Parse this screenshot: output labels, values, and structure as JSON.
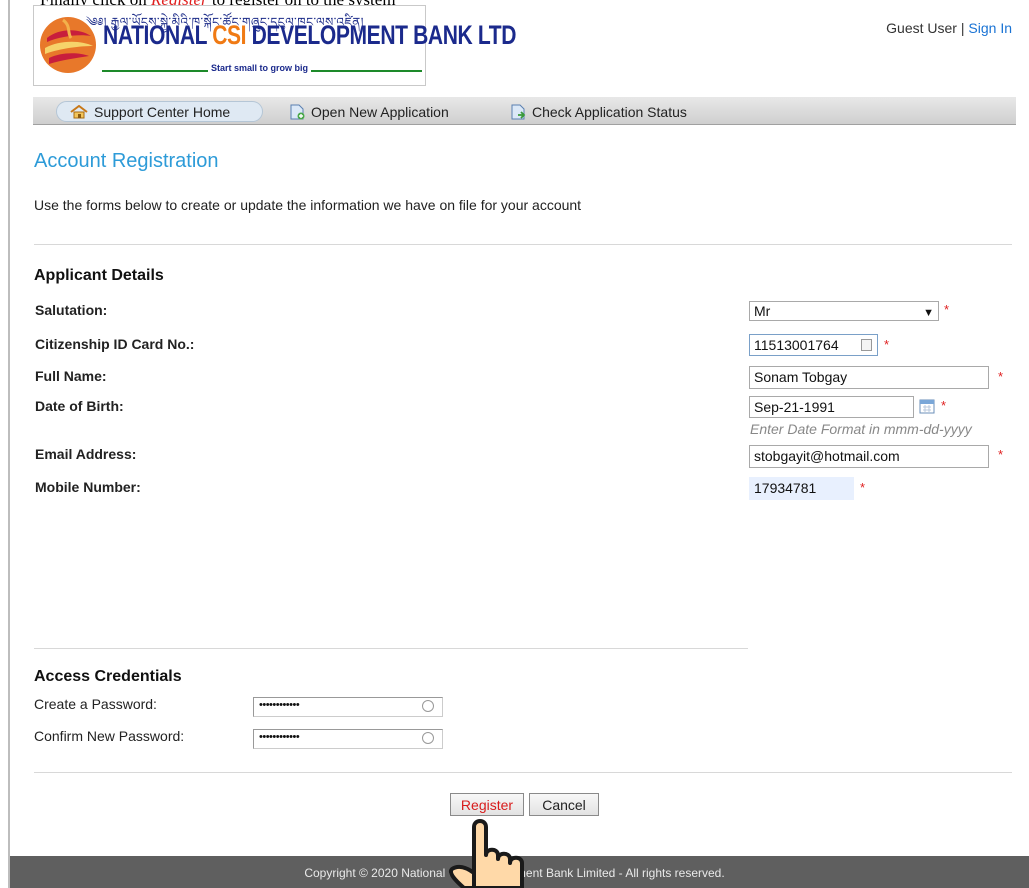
{
  "top_caption": {
    "prefix": "Finally click on ",
    "highlight": "Register",
    "suffix": " to register on to the system"
  },
  "logo": {
    "script_text": "༄༅། རྒྱལ་ཡོངས་སྐྱེ་མིའི་ཁ་སྐོང་ཚོང་གཞུང་དངུལ་ཁང་ལས་འཛིན།",
    "name_part1": "NATIONAL ",
    "name_csi": "CSI",
    "name_part2": " DEVELOPMENT BANK LTD",
    "tagline": "Start small to grow big"
  },
  "account": {
    "guest": "Guest User",
    "separator": " | ",
    "sign_in": "Sign In"
  },
  "nav": {
    "home": "Support Center Home",
    "open_app": "Open New Application",
    "check_status": "Check Application Status"
  },
  "page": {
    "title": "Account Registration",
    "intro": "Use the forms below to create or update the information we have on file for your account"
  },
  "applicant": {
    "heading": "Applicant Details",
    "salutation_label": "Salutation:",
    "salutation_value": "Mr",
    "cid_label": "Citizenship ID Card No.:",
    "cid_value": "11513001764",
    "fullname_label": "Full Name:",
    "fullname_value": "Sonam Tobgay",
    "dob_label": "Date of Birth:",
    "dob_value": "Sep-21-1991",
    "dob_hint": "Enter Date Format in mmm-dd-yyyy",
    "email_label": "Email Address:",
    "email_value": "stobgayit@hotmail.com",
    "mobile_label": "Mobile Number:",
    "mobile_value": "17934781",
    "required_mark": "*"
  },
  "credentials": {
    "heading": "Access Credentials",
    "password_label": "Create a Password:",
    "confirm_label": "Confirm New Password:",
    "password_mask": "••••••••••••",
    "confirm_mask": "••••••••••••"
  },
  "buttons": {
    "register": "Register",
    "cancel": "Cancel"
  },
  "footer": {
    "copyright": "Copyright © 2020 National CSI Development Bank Limited - All rights reserved."
  },
  "colors": {
    "title_blue": "#2d9bd8",
    "required_red": "#e02020",
    "brand_navy": "#1b2a8c",
    "brand_orange": "#f07a14"
  }
}
